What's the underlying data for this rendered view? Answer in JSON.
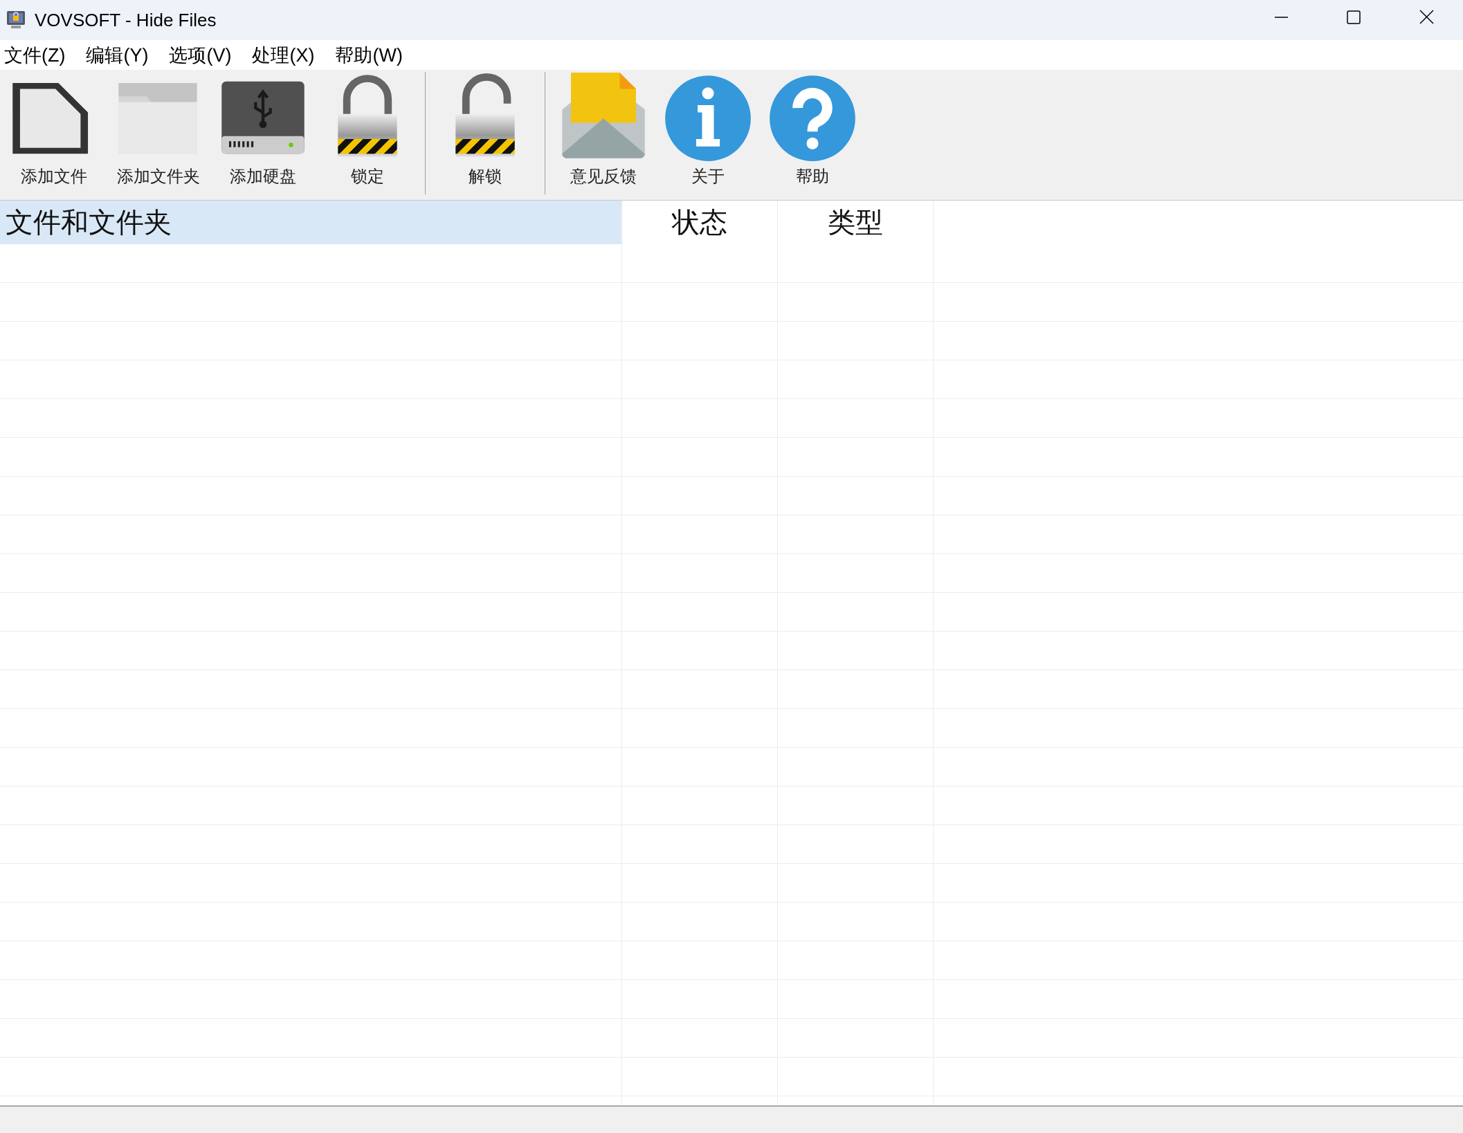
{
  "window": {
    "title": "VOVSOFT - Hide Files"
  },
  "menu": [
    "文件(Z)",
    "编辑(Y)",
    "选项(V)",
    "处理(X)",
    "帮助(W)"
  ],
  "toolbar": [
    [
      {
        "label": "添加文件"
      },
      {
        "label": "添加文件夹"
      },
      {
        "label": "添加硬盘"
      },
      {
        "label": "锁定"
      }
    ],
    [
      {
        "label": "解锁"
      }
    ],
    [
      {
        "label": "意见反馈"
      },
      {
        "label": "关于"
      },
      {
        "label": "帮助"
      }
    ]
  ],
  "table": {
    "columns": [
      {
        "label": "文件和文件夹",
        "selected": true
      },
      {
        "label": "状态",
        "selected": false
      },
      {
        "label": "类型",
        "selected": false
      }
    ]
  }
}
